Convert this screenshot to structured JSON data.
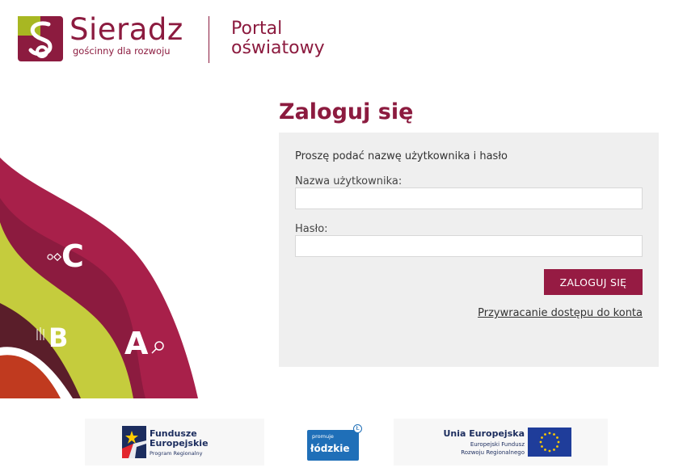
{
  "header": {
    "logo_title": "Sieradz",
    "logo_subtitle": "gościnny dla rozwoju",
    "portal_line1": "Portal",
    "portal_line2": "oświatowy",
    "brand_color": "#8c1b3f",
    "logo_accent_color": "#a8b722"
  },
  "decoration": {
    "letters": [
      "A",
      "B",
      "C"
    ],
    "colors": [
      "#8c1b3f",
      "#a8204a",
      "#c5cc3d",
      "#c03a1f",
      "#5a1e2a"
    ]
  },
  "login": {
    "heading": "Zaloguj się",
    "intro": "Proszę podać nazwę użytkownika i hasło",
    "username_label": "Nazwa użytkownika:",
    "username_value": "",
    "password_label": "Hasło:",
    "password_value": "",
    "submit_label": "ZALOGUJ SIĘ",
    "recover_link": "Przywracanie dostępu do konta",
    "button_color": "#961b43",
    "box_color": "#efefef"
  },
  "footer": {
    "fe_line1": "Fundusze",
    "fe_line2": "Europejskie",
    "fe_line3": "Program Regionalny",
    "lodz_small": "promuje",
    "lodz_big": "łódzkie",
    "lodz_circle": "Ł",
    "ue_line1": "Unia Europejska",
    "ue_line2": "Europejski Fundusz",
    "ue_line3": "Rozwoju Regionalnego",
    "eu_flag_color": "#1f3d9a",
    "eu_star_color": "#ffcc00"
  }
}
